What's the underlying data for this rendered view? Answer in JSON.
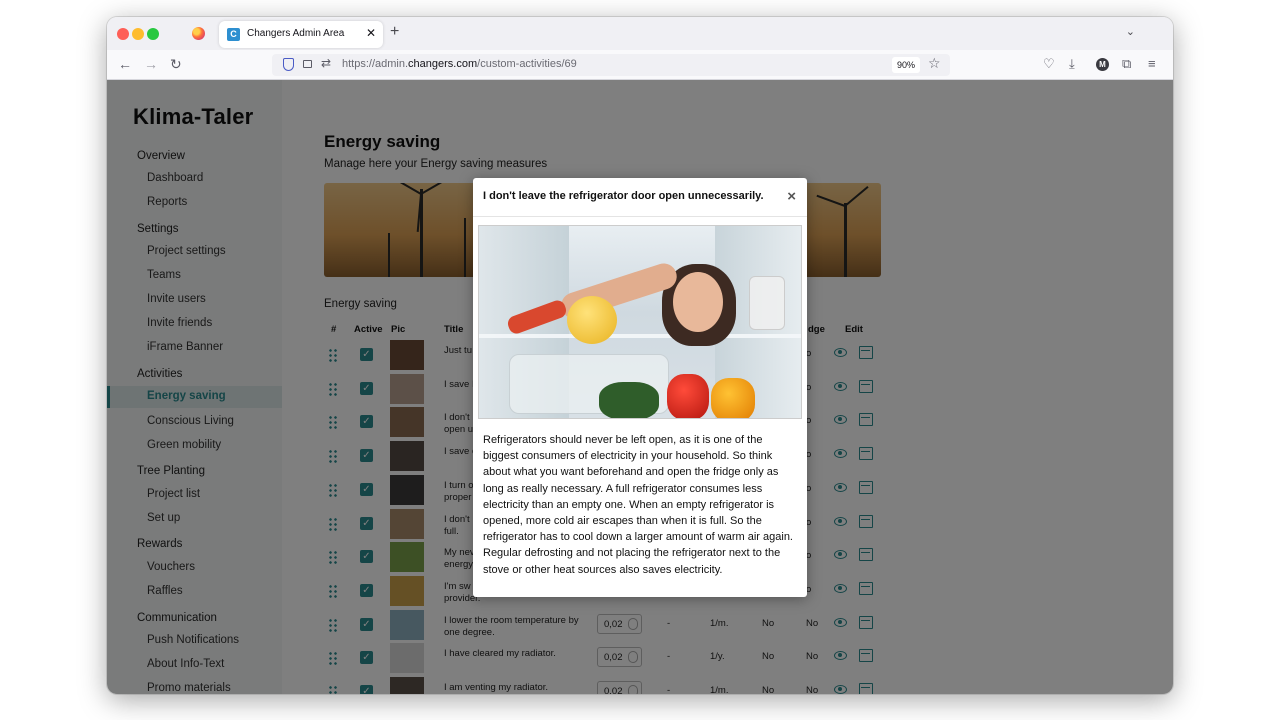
{
  "browser": {
    "tab_title": "Changers Admin Area",
    "tab_favicon_letter": "C",
    "url_prefix": "https://admin.",
    "url_domain": "changers.com",
    "url_path": "/custom-activities/69",
    "zoom": "90%",
    "account_initial": "M"
  },
  "sidebar": {
    "brand": "Klima-Taler",
    "groups": [
      {
        "label": "Overview",
        "items": [
          "Dashboard",
          "Reports"
        ]
      },
      {
        "label": "Settings",
        "items": [
          "Project settings",
          "Teams",
          "Invite users",
          "Invite friends",
          "iFrame Banner"
        ]
      },
      {
        "label": "Activities",
        "items": [
          "Energy saving",
          "Conscious Living",
          "Green mobility"
        ]
      },
      {
        "label": "Tree Planting",
        "items": [
          "Project list",
          "Set up"
        ]
      },
      {
        "label": "Rewards",
        "items": [
          "Vouchers",
          "Raffles"
        ]
      },
      {
        "label": "Communication",
        "items": [
          "Push Notifications",
          "About Info-Text",
          "Promo materials"
        ]
      }
    ],
    "active_item": "Energy saving"
  },
  "main": {
    "title": "Energy saving",
    "subtitle": "Manage here your Energy saving measures",
    "section_label": "Energy saving",
    "columns": {
      "num": "#",
      "active": "Active",
      "pic": "Pic",
      "title": "Title",
      "dge": "dge",
      "edit": "Edit"
    },
    "rows": [
      {
        "title": "Just tu",
        "pts": "",
        "c1": "",
        "c2": "",
        "c3": "",
        "c4": "o"
      },
      {
        "title": "I save I",
        "pts": "",
        "c1": "",
        "c2": "",
        "c3": "",
        "c4": "o"
      },
      {
        "title": "I don't\nopen u",
        "pts": "",
        "c1": "",
        "c2": "",
        "c3": "",
        "c4": "o"
      },
      {
        "title": "I save e",
        "pts": "",
        "c1": "",
        "c2": "",
        "c3": "",
        "c4": "o"
      },
      {
        "title": "I turn o\nproper",
        "pts": "",
        "c1": "",
        "c2": "",
        "c3": "",
        "c4": "o"
      },
      {
        "title": "I don't\nfull.",
        "pts": "",
        "c1": "",
        "c2": "",
        "c3": "",
        "c4": "o"
      },
      {
        "title": "My nev\nenergy",
        "pts": "",
        "c1": "",
        "c2": "",
        "c3": "",
        "c4": "o"
      },
      {
        "title": "I'm sw\nprovider.",
        "pts": "",
        "c1": "",
        "c2": "",
        "c3": "",
        "c4": "o"
      },
      {
        "title": "I lower the room temperature by one degree.",
        "pts": "0,02",
        "c1": "-",
        "c2": "1/m.",
        "c3": "No",
        "c4": "No"
      },
      {
        "title": "I have cleared my radiator.",
        "pts": "0,02",
        "c1": "-",
        "c2": "1/y.",
        "c3": "No",
        "c4": "No"
      },
      {
        "title": "I am venting my radiator.",
        "pts": "0,02",
        "c1": "-",
        "c2": "1/m.",
        "c3": "No",
        "c4": "No"
      }
    ]
  },
  "modal": {
    "title": "I don't leave the refrigerator door open unnecessarily.",
    "close": "×",
    "body": "Refrigerators should never be left open, as it is one of the biggest consumers of electricity in your household. So think about what you want beforehand and open the fridge only as long as really necessary. A full refrigerator consumes less electricity than an empty one. When an empty refrigerator is opened, more cold air escapes than when it is full. So the refrigerator has to cool down a larger amount of warm air again. Regular defrosting and not placing the refrigerator next to the stove or other heat sources also saves electricity."
  },
  "colors": {
    "accent": "#2b8a8e",
    "overlay": "rgba(0,0,0,0.5)"
  }
}
